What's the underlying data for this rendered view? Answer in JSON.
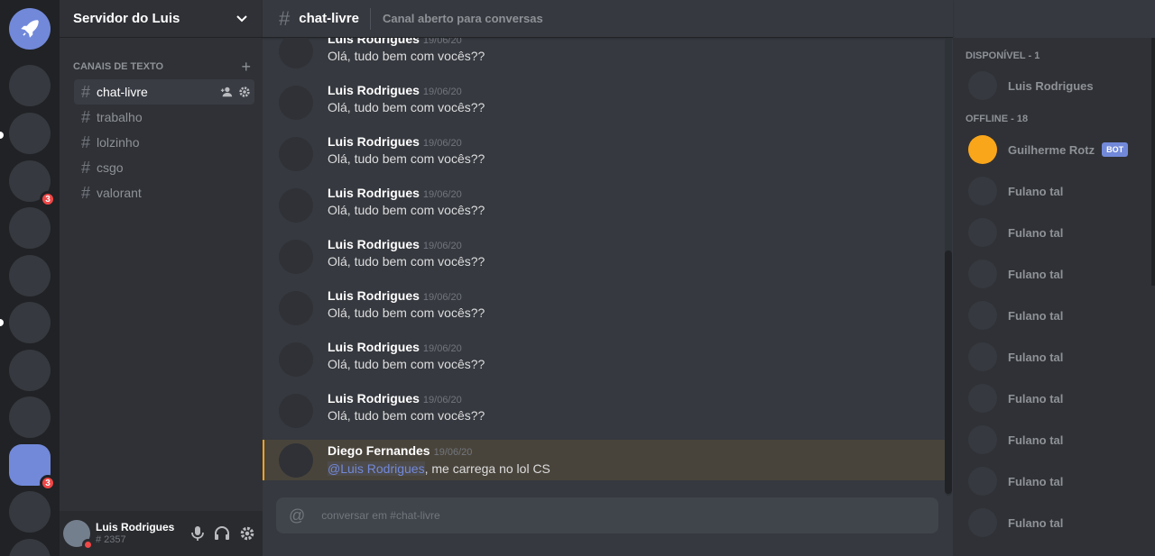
{
  "server": {
    "name": "Servidor do Luis",
    "badge_a": "3",
    "badge_b": "3"
  },
  "sidebar": {
    "category": "CANAIS DE TEXTO",
    "channels": [
      {
        "label": "chat-livre"
      },
      {
        "label": "trabalho"
      },
      {
        "label": "lolzinho"
      },
      {
        "label": "csgo"
      },
      {
        "label": "valorant"
      }
    ]
  },
  "user": {
    "name": "Luis Rodrigues",
    "tag": "# 2357"
  },
  "header": {
    "channel": "chat-livre",
    "topic": "Canal aberto para conversas"
  },
  "messages": [
    {
      "author": "Luis Rodrigues",
      "time": "19/06/20",
      "text": "Olá, tudo bem com vocês??"
    },
    {
      "author": "Luis Rodrigues",
      "time": "19/06/20",
      "text": "Olá, tudo bem com vocês??"
    },
    {
      "author": "Luis Rodrigues",
      "time": "19/06/20",
      "text": "Olá, tudo bem com vocês??"
    },
    {
      "author": "Luis Rodrigues",
      "time": "19/06/20",
      "text": "Olá, tudo bem com vocês??"
    },
    {
      "author": "Luis Rodrigues",
      "time": "19/06/20",
      "text": "Olá, tudo bem com vocês??"
    },
    {
      "author": "Luis Rodrigues",
      "time": "19/06/20",
      "text": "Olá, tudo bem com vocês??"
    },
    {
      "author": "Luis Rodrigues",
      "time": "19/06/20",
      "text": "Olá, tudo bem com vocês??"
    },
    {
      "author": "Luis Rodrigues",
      "time": "19/06/20",
      "text": "Olá, tudo bem com vocês??"
    },
    {
      "author": "Luis Rodrigues",
      "time": "19/06/20",
      "text": "Olá, tudo bem com vocês??"
    }
  ],
  "mention_message": {
    "author": "Diego Fernandes",
    "time": "19/06/20",
    "mention": "@Luis Rodrigues",
    "text": ", me carrega no lol CS"
  },
  "composer": {
    "placeholder": "conversar em #chat-livre"
  },
  "members": {
    "online_header": "DISPONÍVEL - 1",
    "offline_header": "OFFLINE - 18",
    "online": [
      {
        "name": "Luis Rodrigues"
      }
    ],
    "bot": {
      "name": "Guilherme Rotz",
      "tag": "BOT",
      "avatar_color": "#faa61a"
    },
    "offline": [
      {
        "name": "Fulano tal"
      },
      {
        "name": "Fulano tal"
      },
      {
        "name": "Fulano tal"
      },
      {
        "name": "Fulano tal"
      },
      {
        "name": "Fulano tal"
      },
      {
        "name": "Fulano tal"
      },
      {
        "name": "Fulano tal"
      },
      {
        "name": "Fulano tal"
      },
      {
        "name": "Fulano tal"
      }
    ]
  },
  "colors": {
    "accent": "#7289da",
    "mention": "#faa61a",
    "danger": "#f04747"
  }
}
